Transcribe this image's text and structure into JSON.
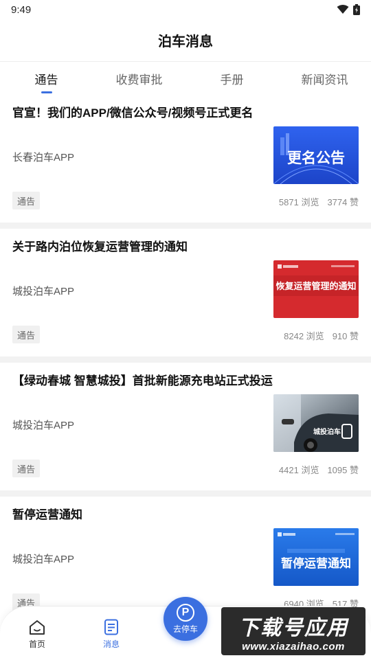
{
  "status_bar": {
    "time": "9:49"
  },
  "header": {
    "title": "泊车消息"
  },
  "tabs": [
    {
      "label": "通告",
      "active": true
    },
    {
      "label": "收费审批",
      "active": false
    },
    {
      "label": "手册",
      "active": false
    },
    {
      "label": "新闻资讯",
      "active": false
    }
  ],
  "articles": [
    {
      "title": "官宣！我们的APP/微信公众号/视频号正式更名",
      "source": "长春泊车APP",
      "tag": "通告",
      "views": "5871 浏览",
      "likes": "3774 赞",
      "thumb_text": "更名公告",
      "thumb_color": "#2d5ce8"
    },
    {
      "title": "关于路内泊位恢复运营管理的通知",
      "source": "城投泊车APP",
      "tag": "通告",
      "views": "8242 浏览",
      "likes": "910 赞",
      "thumb_text": "恢复运营管理的通知",
      "thumb_color": "#d8252c"
    },
    {
      "title": "【绿动春城 智慧城投】首批新能源充电站正式投运",
      "source": "城投泊车APP",
      "tag": "通告",
      "views": "4421 浏览",
      "likes": "1095 赞",
      "thumb_text": "城投泊车",
      "thumb_color": "#4a5560"
    },
    {
      "title": "暂停运营通知",
      "source": "城投泊车APP",
      "tag": "通告",
      "views": "6940 浏览",
      "likes": "517 赞",
      "thumb_text": "暂停运营通知",
      "thumb_color": "#1f6fe0"
    }
  ],
  "bottom_nav": {
    "home": "首页",
    "messages": "消息",
    "park": "去停车"
  },
  "watermark": {
    "cn": "下载号应用",
    "url": "www.xiazaihao.com"
  },
  "colors": {
    "accent": "#3b6fe0"
  }
}
